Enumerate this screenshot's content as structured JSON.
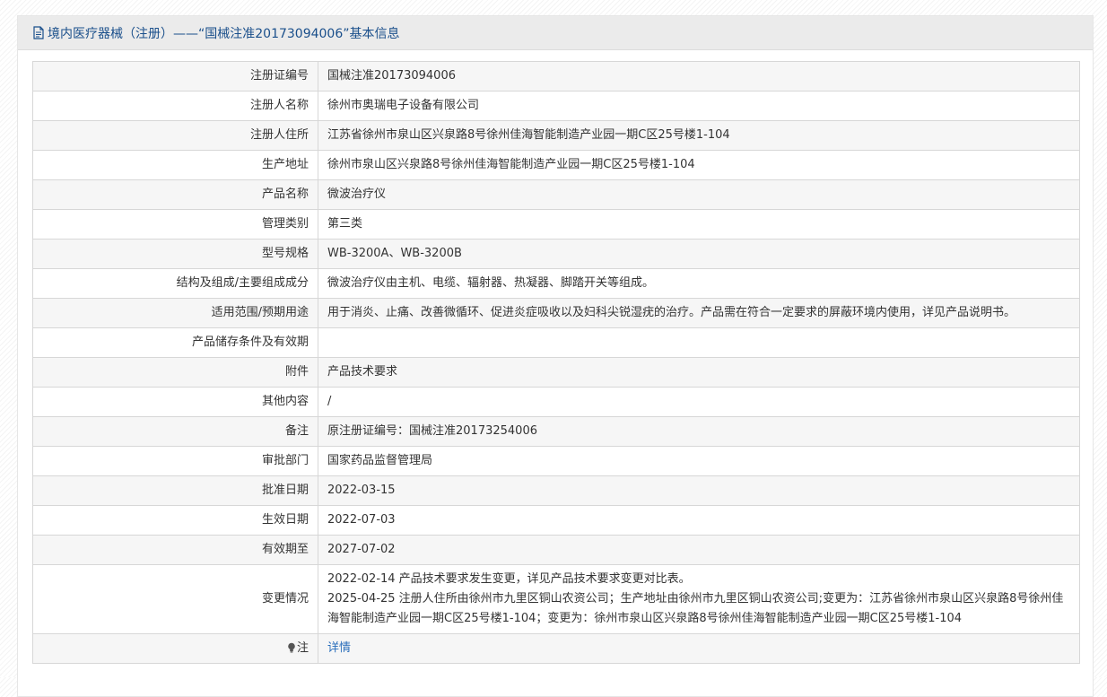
{
  "header": {
    "title": "境内医疗器械（注册）——“国械注准20173094006”基本信息"
  },
  "rows": [
    {
      "label": "注册证编号",
      "value": "国械注准20173094006"
    },
    {
      "label": "注册人名称",
      "value": "徐州市奥瑞电子设备有限公司"
    },
    {
      "label": "注册人住所",
      "value": "江苏省徐州市泉山区兴泉路8号徐州佳海智能制造产业园一期C区25号楼1-104"
    },
    {
      "label": "生产地址",
      "value": "徐州市泉山区兴泉路8号徐州佳海智能制造产业园一期C区25号楼1-104"
    },
    {
      "label": "产品名称",
      "value": "微波治疗仪"
    },
    {
      "label": "管理类别",
      "value": "第三类"
    },
    {
      "label": "型号规格",
      "value": "WB-3200A、WB-3200B"
    },
    {
      "label": "结构及组成/主要组成成分",
      "value": "微波治疗仪由主机、电缆、辐射器、热凝器、脚踏开关等组成。"
    },
    {
      "label": "适用范围/预期用途",
      "value": "用于消炎、止痛、改善微循环、促进炎症吸收以及妇科尖锐湿疣的治疗。产品需在符合一定要求的屏蔽环境内使用，详见产品说明书。"
    },
    {
      "label": "产品储存条件及有效期",
      "value": ""
    },
    {
      "label": "附件",
      "value": "产品技术要求"
    },
    {
      "label": "其他内容",
      "value": "/"
    },
    {
      "label": "备注",
      "value": "原注册证编号：国械注准20173254006"
    },
    {
      "label": "审批部门",
      "value": "国家药品监督管理局"
    },
    {
      "label": "批准日期",
      "value": "2022-03-15"
    },
    {
      "label": "生效日期",
      "value": "2022-07-03"
    },
    {
      "label": "有效期至",
      "value": "2027-07-02"
    }
  ],
  "change": {
    "label": "变更情况",
    "line1": "2022-02-14 产品技术要求发生变更，详见产品技术要求变更对比表。",
    "line2": "2025-04-25 注册人住所由徐州市九里区铜山农资公司；生产地址由徐州市九里区铜山农资公司;变更为：江苏省徐州市泉山区兴泉路8号徐州佳海智能制造产业园一期C区25号楼1-104；变更为：徐州市泉山区兴泉路8号徐州佳海智能制造产业园一期C区25号楼1-104"
  },
  "note": {
    "label": "注",
    "link": "详情"
  },
  "colors": {
    "title": "#1a4f8b",
    "link": "#2a6ebb",
    "border": "#d7d7d7",
    "header_bg": "#ebebeb"
  },
  "icons": {
    "header": "document-icon",
    "note": "lightbulb-icon"
  }
}
